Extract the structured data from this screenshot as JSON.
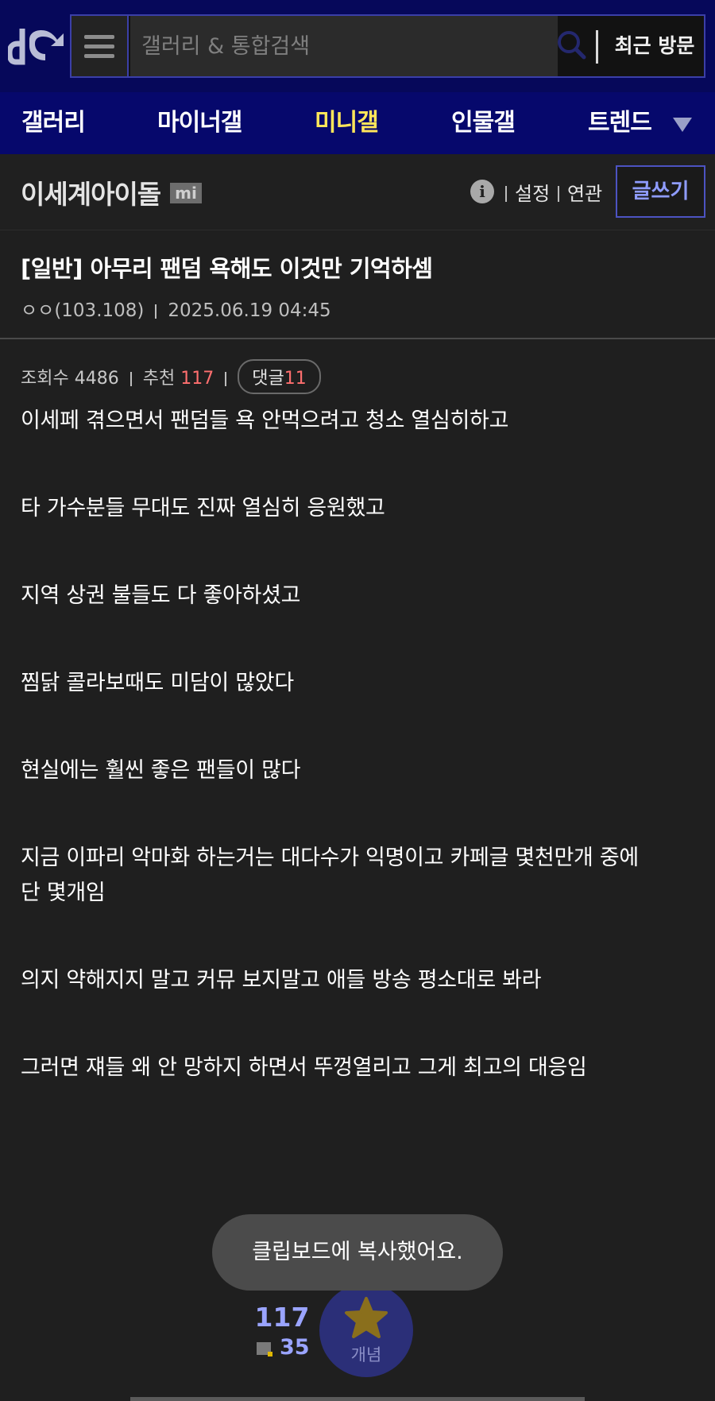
{
  "header": {
    "search_placeholder": "갤러리 & 통합검색",
    "recent_visit_label": "최근 방문",
    "brand_color": "#06085a"
  },
  "nav": {
    "items": [
      {
        "label": "갤러리",
        "active": false
      },
      {
        "label": "마이너갤",
        "active": false
      },
      {
        "label": "미니갤",
        "active": true
      },
      {
        "label": "인물갤",
        "active": false
      },
      {
        "label": "트렌드",
        "active": false
      }
    ],
    "active_color": "#ffe65a"
  },
  "gallery": {
    "name": "이세계아이돌",
    "badge": "mi",
    "info_glyph": "i",
    "settings_label": "설정",
    "related_label": "연관",
    "write_label": "글쓰기"
  },
  "post": {
    "title": "[일반] 아무리 팬덤 욕해도 이것만 기억하셈",
    "author": "ㅇㅇ(103.108)",
    "date": "2025.06.19 04:45",
    "views_label": "조회수",
    "views": "4486",
    "recommend_label": "추천",
    "recommend": "117",
    "comments_label": "댓글",
    "comments": "11",
    "body": [
      "이세페 겪으면서 팬덤들 욕 안먹으려고 청소 열심히하고",
      "타 가수분들 무대도 진짜 열심히 응원했고",
      "지역 상권 불들도 다 좋아하셨고",
      "찜닭 콜라보때도 미담이 많았다",
      "현실에는 훨씬 좋은 팬들이 많다",
      "지금 이파리 악마화 하는거는 대다수가 익명이고 카페글 몇천만개 중에",
      "단 몇개임",
      "의지 약해지지 말고 커뮤 보지말고 애들 방송 평소대로 봐라",
      "그러면 쟤들 왜 안 망하지 하면서 뚜껑열리고 그게 최고의 대응임"
    ]
  },
  "toast": {
    "message": "클립보드에 복사했어요."
  },
  "footer": {
    "recommend_count": "117",
    "fixed_count": "35",
    "concept_label": "개념"
  }
}
